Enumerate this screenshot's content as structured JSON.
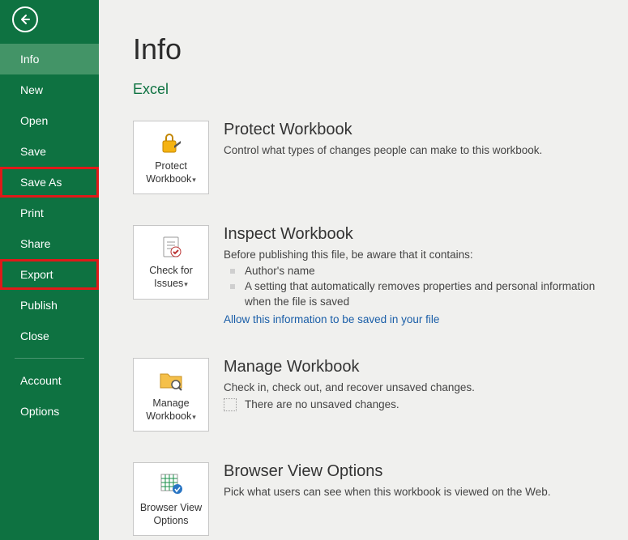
{
  "sidebar": {
    "items": [
      {
        "label": "Info"
      },
      {
        "label": "New"
      },
      {
        "label": "Open"
      },
      {
        "label": "Save"
      },
      {
        "label": "Save As"
      },
      {
        "label": "Print"
      },
      {
        "label": "Share"
      },
      {
        "label": "Export"
      },
      {
        "label": "Publish"
      },
      {
        "label": "Close"
      }
    ],
    "lower": [
      {
        "label": "Account"
      },
      {
        "label": "Options"
      }
    ]
  },
  "page": {
    "title": "Info",
    "subtitle": "Excel"
  },
  "protect": {
    "tile": "Protect Workbook",
    "heading": "Protect Workbook",
    "desc": "Control what types of changes people can make to this workbook."
  },
  "inspect": {
    "tile": "Check for Issues",
    "heading": "Inspect Workbook",
    "desc": "Before publishing this file, be aware that it contains:",
    "bullets": [
      "Author's name",
      "A setting that automatically removes properties and personal information when the file is saved"
    ],
    "link": "Allow this information to be saved in your file"
  },
  "manage": {
    "tile": "Manage Workbook",
    "heading": "Manage Workbook",
    "desc": "Check in, check out, and recover unsaved changes.",
    "empty": "There are no unsaved changes."
  },
  "browser": {
    "tile": "Browser View Options",
    "heading": "Browser View Options",
    "desc": "Pick what users can see when this workbook is viewed on the Web."
  }
}
